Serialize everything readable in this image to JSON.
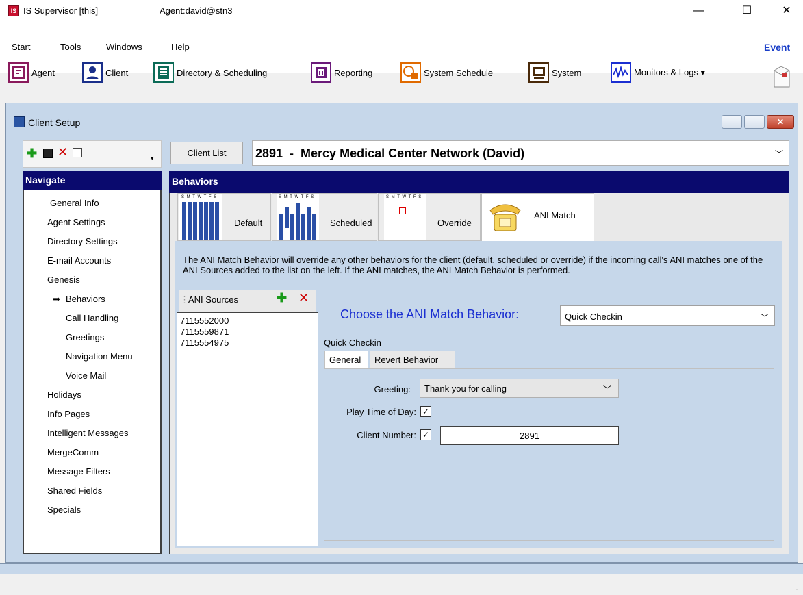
{
  "titlebar": {
    "title": "IS Supervisor [this]",
    "agent": "Agent:david@stn3",
    "logo": "IS"
  },
  "menu": {
    "items": [
      "Start",
      "Tools",
      "Windows",
      "Help"
    ],
    "event": "Event"
  },
  "toolbar": {
    "buttons": [
      {
        "label": "Agent",
        "icon": "agent-icon"
      },
      {
        "label": "Client",
        "icon": "client-icon"
      },
      {
        "label": "Directory & Scheduling",
        "icon": "directory-icon"
      },
      {
        "label": "Reporting",
        "icon": "reporting-icon"
      },
      {
        "label": "System Schedule",
        "icon": "system-schedule-icon"
      },
      {
        "label": "System",
        "icon": "system-icon"
      },
      {
        "label": "Monitors & Logs ▾",
        "icon": "monitors-icon"
      }
    ]
  },
  "client_window": {
    "title": "Client Setup"
  },
  "left": {
    "nav_title": "Navigate",
    "items": [
      "General Info",
      "Agent Settings",
      "Directory Settings",
      "E-mail Accounts",
      "Genesis",
      "Behaviors",
      "Call Handling",
      "Greetings",
      "Navigation Menu",
      "Voice Mail",
      "Holidays",
      "Info Pages",
      "Intelligent Messages",
      "MergeComm",
      "Message Filters",
      "Shared Fields",
      "Specials"
    ]
  },
  "client": {
    "list_button": "Client List",
    "selected": "2891  -  Mercy Medical Center Network (David)"
  },
  "behaviors": {
    "title": "Behaviors",
    "tabs": [
      "Default",
      "Scheduled",
      "Override",
      "ANI Match"
    ],
    "cal_letters": "S M T W T F S",
    "description": "The ANI Match Behavior will override any other behaviors for the client (default, scheduled or override) if the incoming call's ANI matches one of the ANI Sources added to the list on the left. If the ANI matches, the ANI Match Behavior is performed.",
    "ani_sources_label": "ANI Sources",
    "ani_sources": [
      "7115552000",
      "7115559871",
      "7115554975"
    ],
    "choose_label": "Choose the ANI Match Behavior:",
    "choose_value": "Quick Checkin",
    "quick_checkin_label": "Quick Checkin",
    "inner_tabs": [
      "General",
      "Revert Behavior"
    ],
    "greeting_label": "Greeting:",
    "greeting_value": "Thank you for calling",
    "play_time_label": "Play Time of Day:",
    "client_number_label": "Client Number:",
    "client_number_value": "2891"
  }
}
